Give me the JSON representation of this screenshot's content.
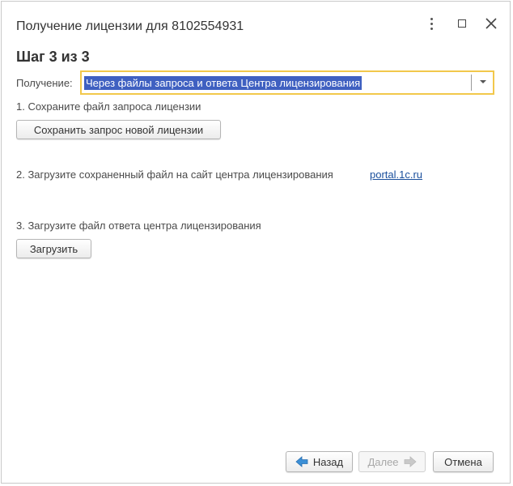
{
  "dialog": {
    "title": "Получение лицензии для 8102554931",
    "step_title": "Шаг 3 из 3"
  },
  "receive": {
    "label": "Получение:",
    "value": "Через файлы запроса и ответа Центра лицензирования"
  },
  "steps": {
    "step1_text": "1. Сохраните файл запроса лицензии",
    "save_button": "Сохранить запрос новой лицензии",
    "step2_text": "2. Загрузите сохраненный файл на сайт центра лицензирования",
    "portal_link": "portal.1c.ru",
    "step3_text": "3. Загрузите файл ответа центра лицензирования",
    "load_button": "Загрузить"
  },
  "footer": {
    "back_label": "Назад",
    "next_label": "Далее",
    "cancel_label": "Отмена"
  },
  "colors": {
    "accent_border": "#f2c84b",
    "selection": "#3f60c1",
    "link": "#1a4f9c",
    "nav_arrow": "#3b8fd6"
  }
}
